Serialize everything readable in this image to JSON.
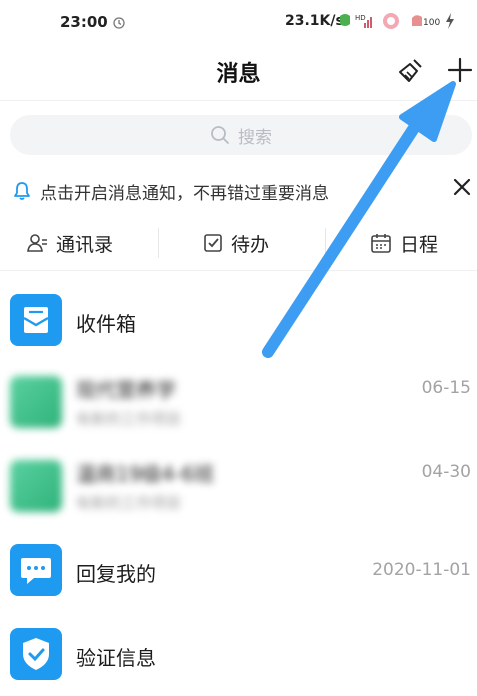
{
  "status_bar": {
    "time": "23:00",
    "network_speed": "23.1K/s",
    "icons": [
      "clock-icon",
      "mascot-icon",
      "hd-signal-icon",
      "game-icon",
      "battery-icon",
      "charging-icon"
    ]
  },
  "header": {
    "title": "消息",
    "actions": [
      "broom-icon",
      "plus-icon"
    ]
  },
  "search": {
    "placeholder": "搜索"
  },
  "notice": {
    "text": "点击开启消息通知，不再错过重要消息"
  },
  "quick": [
    {
      "label": "通讯录",
      "icon": "contacts-icon"
    },
    {
      "label": "待办",
      "icon": "todo-check-icon"
    },
    {
      "label": "日程",
      "icon": "calendar-icon"
    }
  ],
  "list": [
    {
      "name": "收件箱",
      "subtitle": "",
      "date": "",
      "icon": "inbox-icon",
      "blurred": false
    },
    {
      "name": "现代营养学",
      "subtitle": "有新的工作项目",
      "date": "06-15",
      "icon": "group-avatar",
      "blurred": true
    },
    {
      "name": "温商19级4-6班",
      "subtitle": "有新的工作项目",
      "date": "04-30",
      "icon": "group-avatar",
      "blurred": true
    },
    {
      "name": "回复我的",
      "subtitle": "",
      "date": "2020-11-01",
      "icon": "reply-icon",
      "blurred": false
    },
    {
      "name": "验证信息",
      "subtitle": "",
      "date": "",
      "icon": "shield-check-icon",
      "blurred": false
    }
  ],
  "colors": {
    "accent": "#1e9bf0",
    "arrow": "#3d9df2",
    "group_avatar": "#3dbf8a",
    "muted": "#a3a3a3"
  }
}
